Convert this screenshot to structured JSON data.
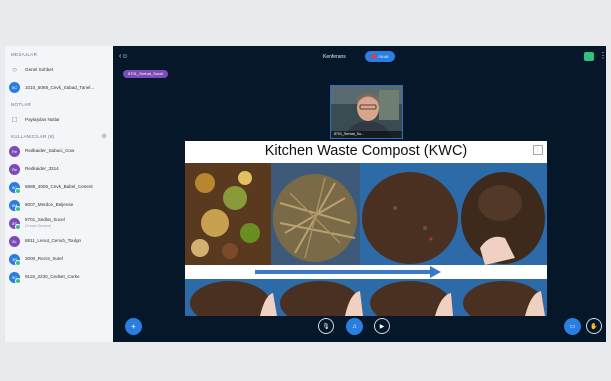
{
  "sidebar": {
    "messages_title": "MESAJLAR",
    "messages": [
      {
        "label": "Genel Sohbet",
        "icon": "chat-icon"
      },
      {
        "label": "1010_5068_Cevk_Sabad_Tanel...",
        "initials": "5C",
        "color": "#2a7de1"
      }
    ],
    "notes_title": "NOTLAR",
    "notes": [
      {
        "label": "Paylaşılan Notlar",
        "icon": "note-icon"
      }
    ],
    "users_title": "KULLANICILAR (8)",
    "users": [
      {
        "label": "Redkaider_Sabaci_Cow",
        "sub": "",
        "initials": "Re",
        "color": "#7b4db8"
      },
      {
        "label": "Redkaider_3314",
        "sub": "",
        "initials": "Re",
        "color": "#7b4db8"
      },
      {
        "label": "8888_4006_Cevk_Babel_Cenent",
        "sub": "",
        "initials": "8C",
        "color": "#2a7de1"
      },
      {
        "label": "8007_Merdce_Beljense",
        "sub": "",
        "initials": "8M",
        "color": "#2a7de1"
      },
      {
        "label": "8701_Sedlat_Sucel",
        "sub": "(Sunan Sensen)",
        "initials": "8S",
        "color": "#7b4db8"
      },
      {
        "label": "8811_Lenut_Cenuh_Toulgn",
        "sub": "",
        "initials": "8L",
        "color": "#7b4db8"
      },
      {
        "label": "3000_Rezot_Sutel",
        "sub": "",
        "initials": "3R",
        "color": "#2a7de1"
      },
      {
        "label": "9118_3230_Cedset_Curke",
        "sub": "",
        "initials": "9C",
        "color": "#2a7de1"
      }
    ]
  },
  "topbar": {
    "room_name": "Kenferans",
    "record_label": "00:46"
  },
  "presenter_tag": "8701_Serbat_Sucel",
  "camera": {
    "name": "8701_Serbat_Su..."
  },
  "slide": {
    "title": "Kitchen Waste Compost (KWC)"
  }
}
